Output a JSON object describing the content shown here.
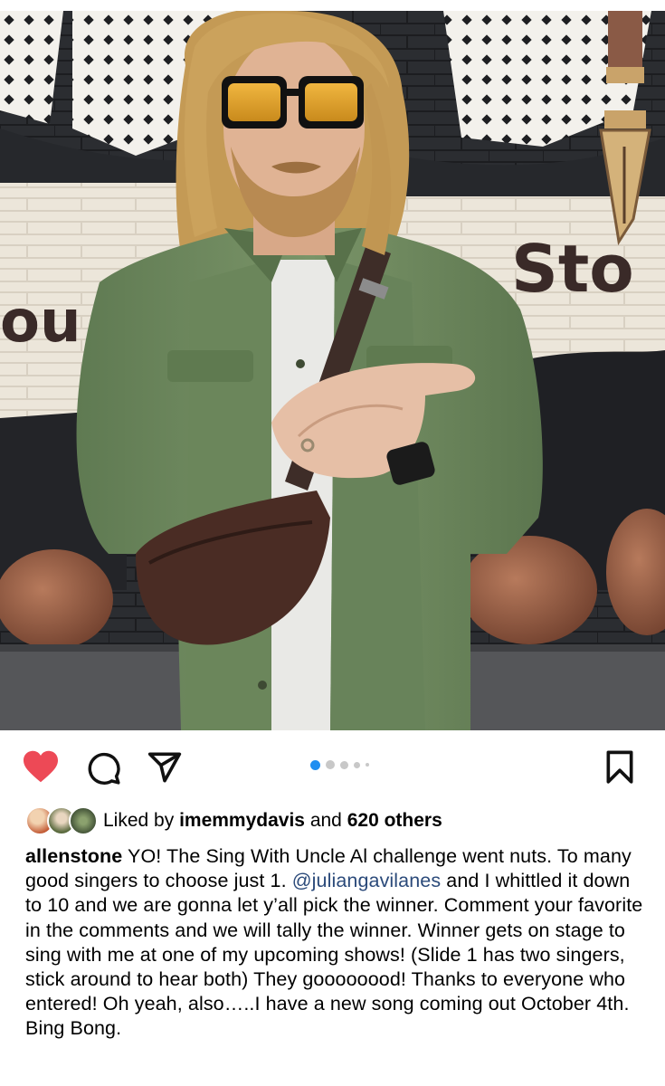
{
  "post": {
    "media": {
      "current_slide": 1,
      "slide_count": 5,
      "wall_text_left": "ou",
      "wall_text_right": "Sto"
    },
    "actions": {
      "like_icon": "heart-filled-icon",
      "comment_icon": "comment-bubble-icon",
      "share_icon": "paper-plane-icon",
      "save_icon": "bookmark-icon",
      "liked": true
    },
    "likes": {
      "prefix": "Liked by",
      "user": "imemmydavis",
      "joiner": "and",
      "others": "620 others"
    },
    "caption": {
      "username": "allenstone",
      "text_before_mention": "YO! The Sing With Uncle Al challenge went nuts. To many good singers to choose just 1.",
      "mention": "@juliangavilanes",
      "text_after_mention": "and I whittled it down to 10 and we are gonna let y’all pick the winner. Comment your favorite in the comments and we will tally the winner. Winner gets on stage to sing with me at one of my upcoming shows! (Slide 1 has two singers, stick around to hear both) They goooooood! Thanks to everyone who entered! Oh yeah, also…..I have a new song coming out October 4th. Bing Bong."
    },
    "colors": {
      "heart": "#ed4956",
      "dot_active": "#1f8ef1",
      "mention": "#2b4a7a",
      "jacket": "#6f8a5f"
    }
  }
}
